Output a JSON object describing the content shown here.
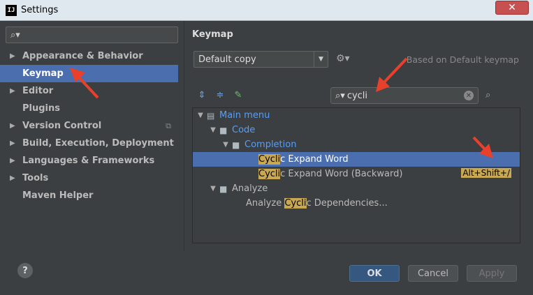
{
  "window": {
    "title": "Settings",
    "app_icon_text": "IJ",
    "close_label": "✕"
  },
  "left_search": {
    "icon": "search-icon",
    "value": ""
  },
  "sidebar": {
    "items": [
      {
        "label": "Appearance & Behavior",
        "expandable": true
      },
      {
        "label": "Keymap",
        "selected": true
      },
      {
        "label": "Editor",
        "expandable": true
      },
      {
        "label": "Plugins"
      },
      {
        "label": "Version Control",
        "expandable": true,
        "has_copy_icon": true
      },
      {
        "label": "Build, Execution, Deployment",
        "expandable": true
      },
      {
        "label": "Languages & Frameworks",
        "expandable": true
      },
      {
        "label": "Tools",
        "expandable": true
      },
      {
        "label": "Maven Helper"
      }
    ]
  },
  "keymap": {
    "title": "Keymap",
    "selected_keymap": "Default copy",
    "based_on": "Based on Default keymap",
    "search_value": "cycli",
    "tree": {
      "main_menu": "Main menu",
      "code": "Code",
      "completion": "Completion",
      "cyclic_expand_pre": "Cycli",
      "cyclic_expand_post": "c Expand Word",
      "cyclic_back_pre": "Cycli",
      "cyclic_back_post": "c Expand Word (Backward)",
      "cyclic_back_shortcut": "Alt+Shift+/",
      "analyze": "Analyze",
      "analyze_dep_pre": "Analyze ",
      "analyze_dep_hl": "Cycli",
      "analyze_dep_post": "c Dependencies..."
    }
  },
  "footer": {
    "help": "?",
    "ok": "OK",
    "cancel": "Cancel",
    "apply": "Apply"
  },
  "colors": {
    "background": "#3c3f41",
    "selection": "#4b6eaf",
    "highlight": "#c9a854",
    "annotation_arrow": "#e8402a"
  }
}
